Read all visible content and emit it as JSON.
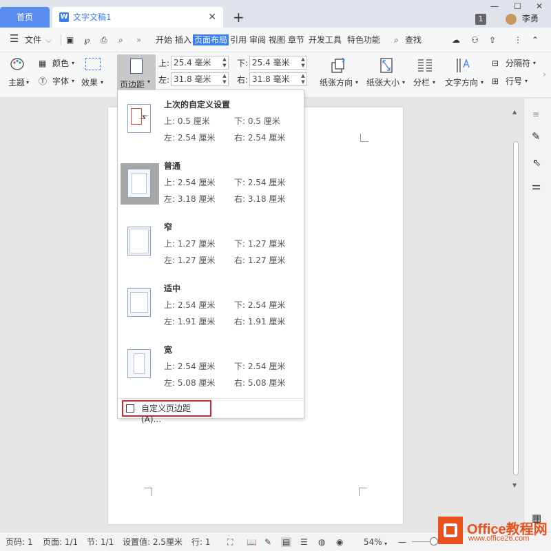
{
  "tabs": {
    "home": "首页",
    "doc_title": "文字文稿1",
    "close": "✕",
    "new": "+"
  },
  "titlebar": {
    "window_count": "1",
    "username": "李勇"
  },
  "menu": {
    "file": "文件",
    "items": [
      "开始",
      "插入",
      "页面布局",
      "引用",
      "审阅",
      "视图",
      "章节",
      "开发工具",
      "特色功能"
    ],
    "active": "页面布局",
    "search": "查找"
  },
  "ribbon": {
    "theme": "主题",
    "color": "颜色",
    "font": "字体",
    "effect": "效果",
    "margins": "页边距",
    "top_label": "上:",
    "top_value": "25.4 毫米",
    "bottom_label": "下:",
    "bottom_value": "25.4 毫米",
    "left_label": "左:",
    "left_value": "31.8 毫米",
    "right_label": "右:",
    "right_value": "31.8 毫米",
    "orientation": "纸张方向",
    "size": "纸张大小",
    "columns": "分栏",
    "text_direction": "文字方向",
    "breaks": "分隔符",
    "line_numbers": "行号"
  },
  "margin_presets": [
    {
      "name": "上次的自定义设置",
      "top": "上: 0.5 厘米",
      "bottom": "下: 0.5 厘米",
      "left": "左: 2.54 厘米",
      "right": "右: 2.54 厘米"
    },
    {
      "name": "普通",
      "top": "上: 2.54 厘米",
      "bottom": "下: 2.54 厘米",
      "left": "左: 3.18 厘米",
      "right": "右: 3.18 厘米"
    },
    {
      "name": "窄",
      "top": "上: 1.27 厘米",
      "bottom": "下: 1.27 厘米",
      "left": "左: 1.27 厘米",
      "right": "右: 1.27 厘米"
    },
    {
      "name": "适中",
      "top": "上: 2.54 厘米",
      "bottom": "下: 2.54 厘米",
      "left": "左: 1.91 厘米",
      "right": "右: 1.91 厘米"
    },
    {
      "name": "宽",
      "top": "上: 2.54 厘米",
      "bottom": "下: 2.54 厘米",
      "left": "左: 5.08 厘米",
      "right": "右: 5.08 厘米"
    }
  ],
  "custom_margins": "自定义页边距(A)...",
  "status": {
    "page_code": "页码: 1",
    "pages": "页面: 1/1",
    "section": "节: 1/1",
    "setting": "设置值: 2.5厘米",
    "line": "行: 1",
    "zoom": "54%"
  },
  "watermark": {
    "brand": "Office教程网",
    "url": "www.office26.com"
  },
  "colors": {
    "accent": "#3a7ff2",
    "home_tab": "#5b8def",
    "highlight_border": "#d9262c",
    "watermark": "#e8531d"
  }
}
